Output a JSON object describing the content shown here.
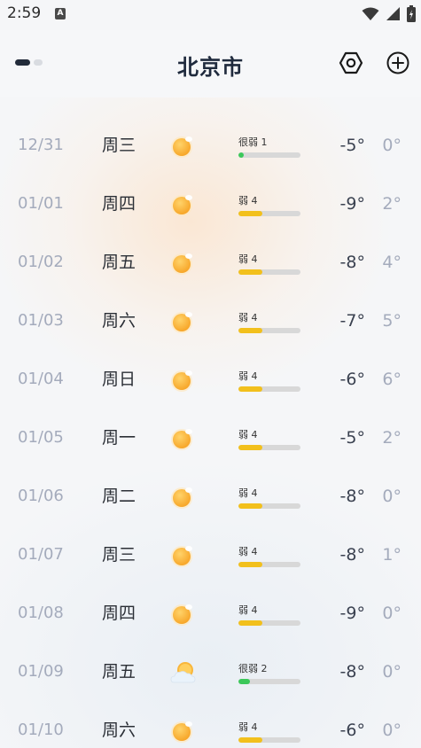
{
  "status_bar": {
    "time": "2:59",
    "notification_letter": "A"
  },
  "header": {
    "city": "北京市",
    "page_indicator": {
      "active": 1,
      "total": 2
    }
  },
  "colors": {
    "aqi_level_1": "#3cc85a",
    "aqi_level_2": "#3cc85a",
    "aqi_level_4": "#f2c01c",
    "title": "#1f2a3d",
    "muted_text": "#a4abbc"
  },
  "forecast": [
    {
      "date": "12/31",
      "weekday": "周三",
      "icon": "sunny-icon",
      "aqi_label": "很弱 1",
      "aqi_level": 1,
      "aqi_fraction": 0.08,
      "low": "-5°",
      "high": "0°"
    },
    {
      "date": "01/01",
      "weekday": "周四",
      "icon": "sunny-icon",
      "aqi_label": "弱 4",
      "aqi_level": 4,
      "aqi_fraction": 0.38,
      "low": "-9°",
      "high": "2°"
    },
    {
      "date": "01/02",
      "weekday": "周五",
      "icon": "sunny-icon",
      "aqi_label": "弱 4",
      "aqi_level": 4,
      "aqi_fraction": 0.38,
      "low": "-8°",
      "high": "4°"
    },
    {
      "date": "01/03",
      "weekday": "周六",
      "icon": "sunny-icon",
      "aqi_label": "弱 4",
      "aqi_level": 4,
      "aqi_fraction": 0.38,
      "low": "-7°",
      "high": "5°"
    },
    {
      "date": "01/04",
      "weekday": "周日",
      "icon": "sunny-icon",
      "aqi_label": "弱 4",
      "aqi_level": 4,
      "aqi_fraction": 0.38,
      "low": "-6°",
      "high": "6°"
    },
    {
      "date": "01/05",
      "weekday": "周一",
      "icon": "sunny-icon",
      "aqi_label": "弱 4",
      "aqi_level": 4,
      "aqi_fraction": 0.38,
      "low": "-5°",
      "high": "2°"
    },
    {
      "date": "01/06",
      "weekday": "周二",
      "icon": "sunny-icon",
      "aqi_label": "弱 4",
      "aqi_level": 4,
      "aqi_fraction": 0.38,
      "low": "-8°",
      "high": "0°"
    },
    {
      "date": "01/07",
      "weekday": "周三",
      "icon": "sunny-icon",
      "aqi_label": "弱 4",
      "aqi_level": 4,
      "aqi_fraction": 0.38,
      "low": "-8°",
      "high": "1°"
    },
    {
      "date": "01/08",
      "weekday": "周四",
      "icon": "sunny-icon",
      "aqi_label": "弱 4",
      "aqi_level": 4,
      "aqi_fraction": 0.38,
      "low": "-9°",
      "high": "0°"
    },
    {
      "date": "01/09",
      "weekday": "周五",
      "icon": "partly-cloudy-icon",
      "aqi_label": "很弱 2",
      "aqi_level": 2,
      "aqi_fraction": 0.18,
      "low": "-8°",
      "high": "0°"
    },
    {
      "date": "01/10",
      "weekday": "周六",
      "icon": "sunny-icon",
      "aqi_label": "弱 4",
      "aqi_level": 4,
      "aqi_fraction": 0.38,
      "low": "-6°",
      "high": "0°"
    }
  ]
}
